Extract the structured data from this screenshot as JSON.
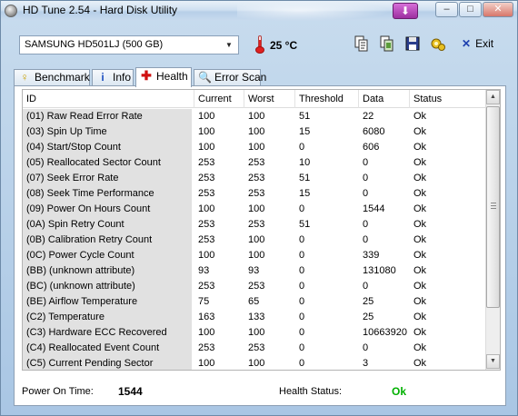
{
  "window": {
    "title": "HD Tune 2.54 - Hard Disk Utility",
    "caption_buttons": [
      "–",
      "□",
      "✕"
    ]
  },
  "toolbar": {
    "drive": "SAMSUNG HD501LJ (500 GB)",
    "temperature": "25 °C",
    "exit_label": "Exit",
    "icons": [
      "copy-info-icon",
      "copy-screenshot-icon",
      "save-icon",
      "options-icon"
    ]
  },
  "tabs": [
    {
      "label": "Benchmark",
      "icon": "benchmark-icon"
    },
    {
      "label": "Info",
      "icon": "info-icon"
    },
    {
      "label": "Health",
      "icon": "health-icon",
      "active": true
    },
    {
      "label": "Error Scan",
      "icon": "error-scan-icon"
    }
  ],
  "health": {
    "columns": [
      "ID",
      "Current",
      "Worst",
      "Threshold",
      "Data",
      "Status"
    ],
    "rows": [
      [
        "(01) Raw Read Error Rate",
        "100",
        "100",
        "51",
        "22",
        "Ok"
      ],
      [
        "(03) Spin Up Time",
        "100",
        "100",
        "15",
        "6080",
        "Ok"
      ],
      [
        "(04) Start/Stop Count",
        "100",
        "100",
        "0",
        "606",
        "Ok"
      ],
      [
        "(05) Reallocated Sector Count",
        "253",
        "253",
        "10",
        "0",
        "Ok"
      ],
      [
        "(07) Seek Error Rate",
        "253",
        "253",
        "51",
        "0",
        "Ok"
      ],
      [
        "(08) Seek Time Performance",
        "253",
        "253",
        "15",
        "0",
        "Ok"
      ],
      [
        "(09) Power On Hours Count",
        "100",
        "100",
        "0",
        "1544",
        "Ok"
      ],
      [
        "(0A) Spin Retry Count",
        "253",
        "253",
        "51",
        "0",
        "Ok"
      ],
      [
        "(0B) Calibration Retry Count",
        "253",
        "100",
        "0",
        "0",
        "Ok"
      ],
      [
        "(0C) Power Cycle Count",
        "100",
        "100",
        "0",
        "339",
        "Ok"
      ],
      [
        "(BB) (unknown attribute)",
        "93",
        "93",
        "0",
        "131080",
        "Ok"
      ],
      [
        "(BC) (unknown attribute)",
        "253",
        "253",
        "0",
        "0",
        "Ok"
      ],
      [
        "(BE) Airflow Temperature",
        "75",
        "65",
        "0",
        "25",
        "Ok"
      ],
      [
        "(C2) Temperature",
        "163",
        "133",
        "0",
        "25",
        "Ok"
      ],
      [
        "(C3) Hardware ECC Recovered",
        "100",
        "100",
        "0",
        "10663920",
        "Ok"
      ],
      [
        "(C4) Reallocated Event Count",
        "253",
        "253",
        "0",
        "0",
        "Ok"
      ],
      [
        "(C5) Current Pending Sector",
        "100",
        "100",
        "0",
        "3",
        "Ok"
      ]
    ],
    "power_on_time_label": "Power On Time:",
    "power_on_time_value": "1544",
    "health_status_label": "Health Status:",
    "health_status_value": "Ok",
    "ok_color": "#00b000"
  }
}
